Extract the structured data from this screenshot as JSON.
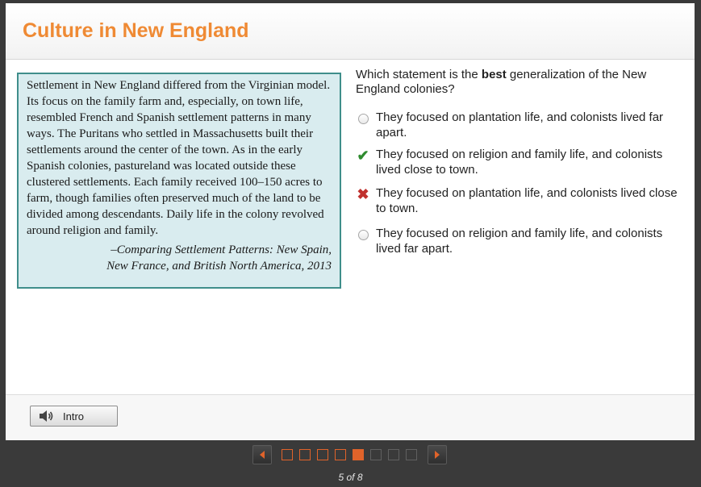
{
  "header": {
    "title": "Culture in New England"
  },
  "passage": {
    "text": "Settlement in New England differed from the Virginian model. Its focus on the family farm and, especially, on town life, resembled French and Spanish settlement patterns in many ways. The Puritans who settled in Massachusetts built their settlements around the center of the town. As in the early Spanish colonies, pastureland was located outside these clustered settlements. Each family received 100–150 acres to farm, though families often preserved much of the land to be divided among descendants. Daily life in the colony revolved around religion and family.",
    "citation_line1": "–Comparing Settlement Patterns: New Spain,",
    "citation_line2": "New France, and British North America, 2013"
  },
  "question": {
    "prefix": "Which statement is the ",
    "emphasis": "best",
    "suffix": " generalization of the New England colonies?"
  },
  "options": [
    {
      "text": "They focused on plantation life, and colonists lived far apart.",
      "state": "unselected"
    },
    {
      "text": "They focused on religion and family life, and colonists lived close to town.",
      "state": "correct"
    },
    {
      "text": "They focused on plantation life, and colonists lived close to town.",
      "state": "incorrect"
    },
    {
      "text": "They focused on religion and family life, and colonists lived far apart.",
      "state": "unselected"
    }
  ],
  "footer": {
    "intro_label": "Intro"
  },
  "pagination": {
    "label": "5 of 8",
    "current": 5,
    "total": 8
  },
  "colors": {
    "title": "#ef8a34",
    "accent": "#e0632a",
    "correct": "#2e8b2e",
    "incorrect": "#c0312e",
    "passage_bg": "#d9ecef",
    "passage_border": "#3f8e8b"
  }
}
